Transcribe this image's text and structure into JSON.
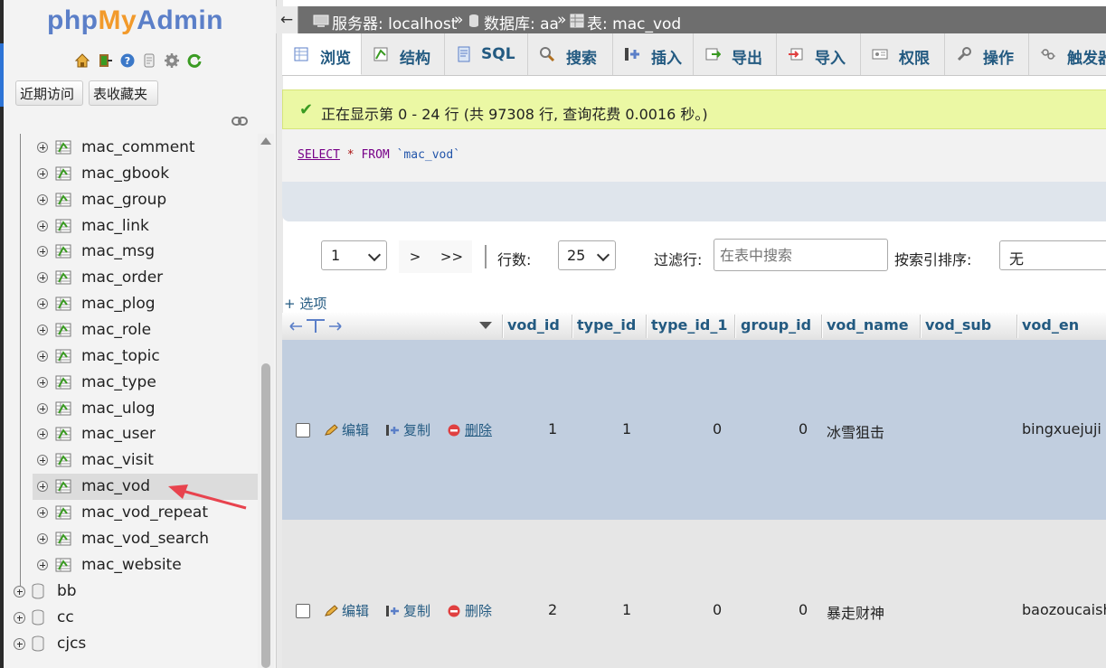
{
  "logo": {
    "php": "php",
    "my": "My",
    "admin": "Admin"
  },
  "nav": {
    "recent": "近期访问",
    "favorites": "表收藏夹"
  },
  "tree": {
    "tables": [
      "mac_comment",
      "mac_gbook",
      "mac_group",
      "mac_link",
      "mac_msg",
      "mac_order",
      "mac_plog",
      "mac_role",
      "mac_topic",
      "mac_type",
      "mac_ulog",
      "mac_user",
      "mac_visit",
      "mac_vod",
      "mac_vod_repeat",
      "mac_vod_search",
      "mac_website"
    ],
    "selected": "mac_vod",
    "databases": [
      "bb",
      "cc",
      "cjcs"
    ]
  },
  "breadcrumb": {
    "back": "←",
    "server": "服务器: localhost",
    "sep1": "»",
    "database": "数据库: aa",
    "sep2": "»",
    "table": "表: mac_vod"
  },
  "tabs": [
    "浏览",
    "结构",
    "SQL",
    "搜索",
    "插入",
    "导出",
    "导入",
    "权限",
    "操作",
    "触发器"
  ],
  "message": "正在显示第 0 - 24 行 (共 97308 行, 查询花费 0.0016 秒。)",
  "sql": {
    "select": "SELECT",
    "star": "*",
    "from": "FROM",
    "table": "`mac_vod`"
  },
  "pager": {
    "page": "1",
    "next": ">",
    "last": ">>",
    "rows_label": "行数:",
    "rows_value": "25",
    "filter_label": "过滤行:",
    "filter_placeholder": "在表中搜索",
    "sort_label": "按索引排序:",
    "sort_value": "无"
  },
  "options_link": "+ 选项",
  "columns": [
    "vod_id",
    "type_id",
    "type_id_1",
    "group_id",
    "vod_name",
    "vod_sub",
    "vod_en"
  ],
  "actions": {
    "edit": "编辑",
    "copy": "复制",
    "delete": "删除"
  },
  "rows": [
    {
      "vod_id": "1",
      "type_id": "1",
      "type_id_1": "0",
      "group_id": "0",
      "vod_name": "冰雪狙击",
      "vod_sub": "",
      "vod_en": "bingxuejuji"
    },
    {
      "vod_id": "2",
      "type_id": "1",
      "type_id_1": "0",
      "group_id": "0",
      "vod_name": "暴走财神",
      "vod_sub": "",
      "vod_en": "baozoucaish"
    }
  ],
  "colors": {
    "link": "#235a81",
    "success_bg": "#ebf8a4",
    "row_highlight": "#c1cedf",
    "arrow": "#e8434e"
  }
}
